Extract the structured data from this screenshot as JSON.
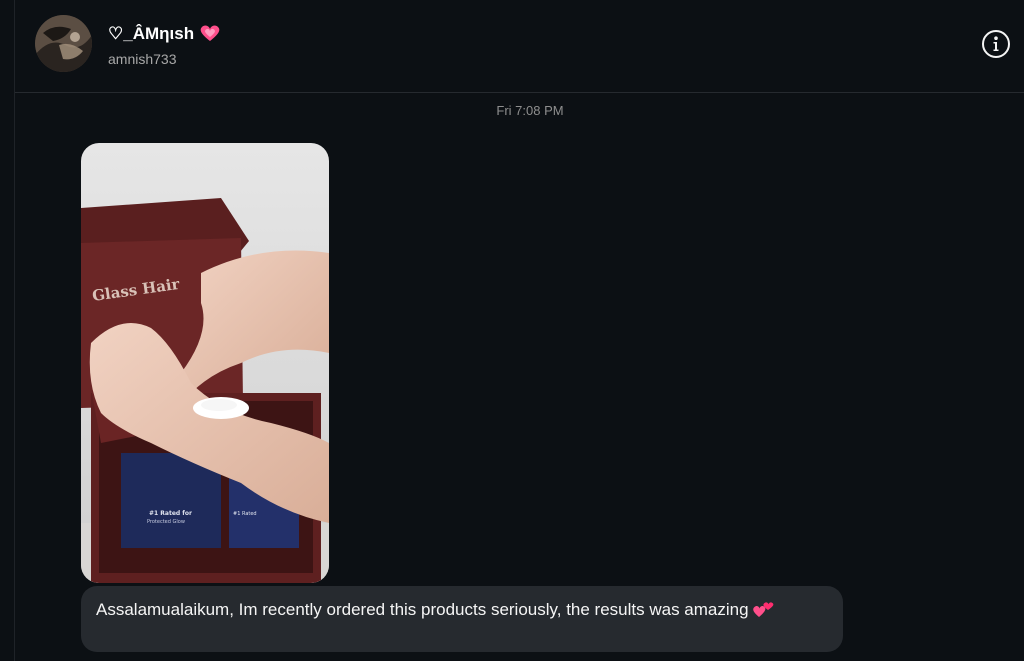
{
  "header": {
    "display_name": "♡_ÂΜηιsh",
    "username": "amnish733",
    "icons": {
      "avatar": "profile-photo",
      "name_badge": "pink-heart-icon",
      "info": "info-circle-icon"
    }
  },
  "conversation": {
    "timestamp": "Fri 7:08 PM",
    "media": {
      "type": "photo",
      "box_lines": [
        "Glass Hair"
      ],
      "product_label": "#1 Rated for Protected Glow"
    },
    "message": {
      "text": "Assalamualaikum,  Im recently ordered this products  seriously, the results was amazing",
      "emoji": "two-hearts-icon"
    }
  },
  "colors": {
    "background": "#0c1014",
    "bubble": "#262a2f",
    "muted_text": "#a8a8a8",
    "timestamp_text": "#8e8e8e",
    "heart_pink": "#ff4f8b"
  }
}
